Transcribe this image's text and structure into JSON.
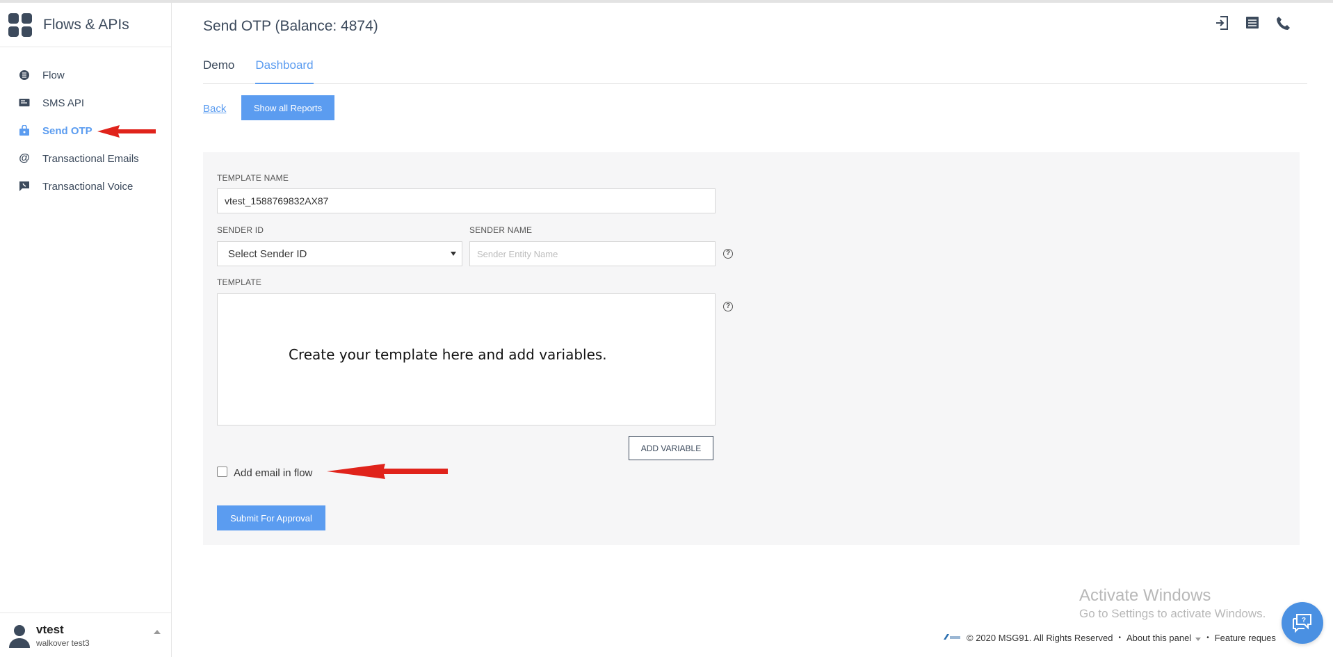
{
  "sidebar": {
    "title": "Flows & APIs",
    "items": [
      {
        "label": "Flow",
        "icon": "flow-icon"
      },
      {
        "label": "SMS API",
        "icon": "sms-icon"
      },
      {
        "label": "Send OTP",
        "icon": "otp-icon",
        "active": true
      },
      {
        "label": "Transactional Emails",
        "icon": "at-icon"
      },
      {
        "label": "Transactional Voice",
        "icon": "voice-icon"
      }
    ],
    "user": {
      "name": "vtest",
      "sub": "walkover test3"
    }
  },
  "header": {
    "title": "Send OTP (Balance: 4874)",
    "icons": [
      "logout-icon",
      "list-icon",
      "phone-icon"
    ]
  },
  "tabs": [
    {
      "label": "Demo",
      "active": false
    },
    {
      "label": "Dashboard",
      "active": true
    }
  ],
  "toolbar": {
    "back_label": "Back",
    "reports_label": "Show all Reports"
  },
  "form": {
    "template_name_label": "TEMPLATE NAME",
    "template_name_value": "vtest_1588769832AX87",
    "sender_id_label": "SENDER ID",
    "sender_id_selected": "Select Sender ID",
    "sender_name_label": "SENDER NAME",
    "sender_name_placeholder": "Sender Entity Name",
    "template_label": "TEMPLATE",
    "template_hint": "Create your template here and add variables.",
    "add_variable_label": "ADD VARIABLE",
    "add_email_label": "Add email in flow",
    "submit_label": "Submit For Approval"
  },
  "watermark": {
    "line1": "Activate Windows",
    "line2": "Go to Settings to activate Windows."
  },
  "footer": {
    "copyright": "© 2020 MSG91. All Rights Reserved",
    "about": "About this panel",
    "feature": "Feature reques"
  },
  "colors": {
    "accent": "#5b9cf0",
    "text": "#3c4a5c",
    "panel_bg": "#f6f6f7",
    "annotation": "#e0231b"
  }
}
